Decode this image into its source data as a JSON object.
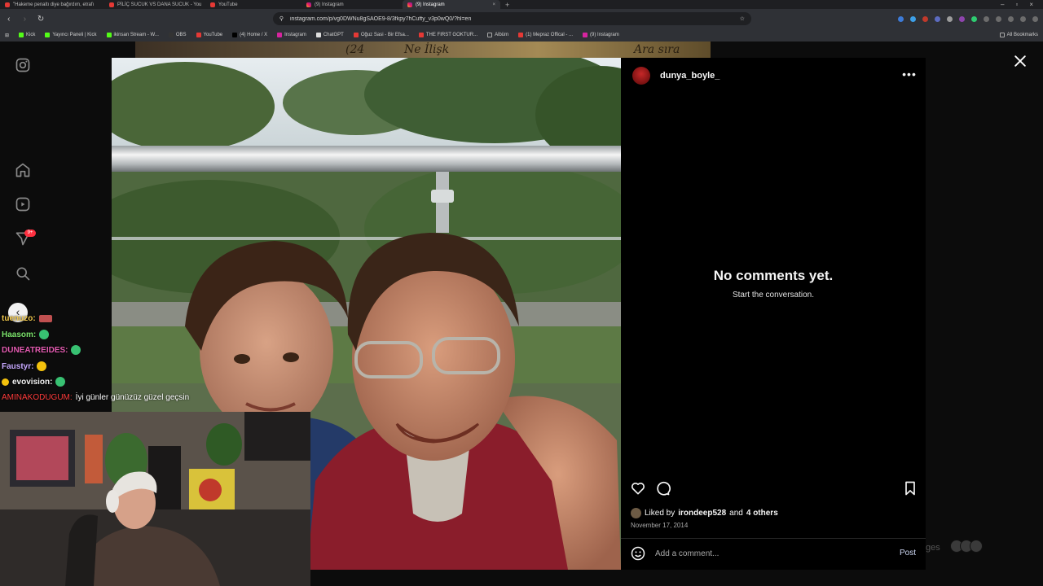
{
  "browser": {
    "tabs": [
      {
        "title": "\"Hakeme penaltı diye bağırdım, etrafı",
        "icon": "youtube"
      },
      {
        "title": "PİLİÇ SUCUK VS DANA SUCUK - You",
        "icon": "youtube"
      },
      {
        "title": "YouTube",
        "icon": "youtube"
      },
      {
        "title": "(9) Instagram",
        "icon": "instagram"
      },
      {
        "title": "(9) Instagram",
        "icon": "instagram",
        "active": true
      }
    ],
    "url": "instagram.com/p/vg0DWNu8gSAOE9-8/3fkpy7hCufty_v3p0wQ0/?hl=en",
    "bookmarks": [
      "Kick",
      "Yayıncı Paneli | Kick",
      "ikinsan Stream - W...",
      "OBS",
      "YouTube",
      "(4) Home / X",
      "Instagram",
      "ChatGPT",
      "Oğuz Sasi - Bir Efsa...",
      "THE FIRST GOKTUR...",
      "Albüm",
      "(1) Mepraz Offical - ...",
      "(9) Instagram"
    ],
    "all_bookmarks": "All Bookmarks"
  },
  "post": {
    "username": "dunya_boyle_",
    "no_comments_title": "No comments yet.",
    "no_comments_sub": "Start the conversation.",
    "liked_by_prefix": "Liked by",
    "liked_by_user": "irondeep528",
    "liked_by_and": "and",
    "liked_by_others": "4 others",
    "date": "November 17, 2014",
    "comment_placeholder": "Add a comment...",
    "post_label": "Post"
  },
  "background_text": [
    "(24",
    "Ne İlişk",
    "Ara sıra"
  ],
  "ghost_label": "ges",
  "notif_badge": "9+",
  "chat": [
    {
      "user": "tuenuzo:",
      "color": "#f2c94c",
      "msg": "",
      "emote": "box"
    },
    {
      "user": "Haasom:",
      "color": "#7be26b",
      "msg": "",
      "emote": "green"
    },
    {
      "user": "DUNEATREIDES:",
      "color": "#e35bb0",
      "msg": "",
      "emote": "green"
    },
    {
      "user": "Faustyr:",
      "color": "#c7a9ff",
      "msg": "",
      "emote": "yellow"
    },
    {
      "user": "evovision:",
      "color": "#f2f2f2",
      "msg": "",
      "emote": "green"
    },
    {
      "user": "AMINAKODUGUM:",
      "color": "#ff3b3b",
      "msg": "İyi günler günüzüz güzel geçsin",
      "emote": ""
    }
  ]
}
